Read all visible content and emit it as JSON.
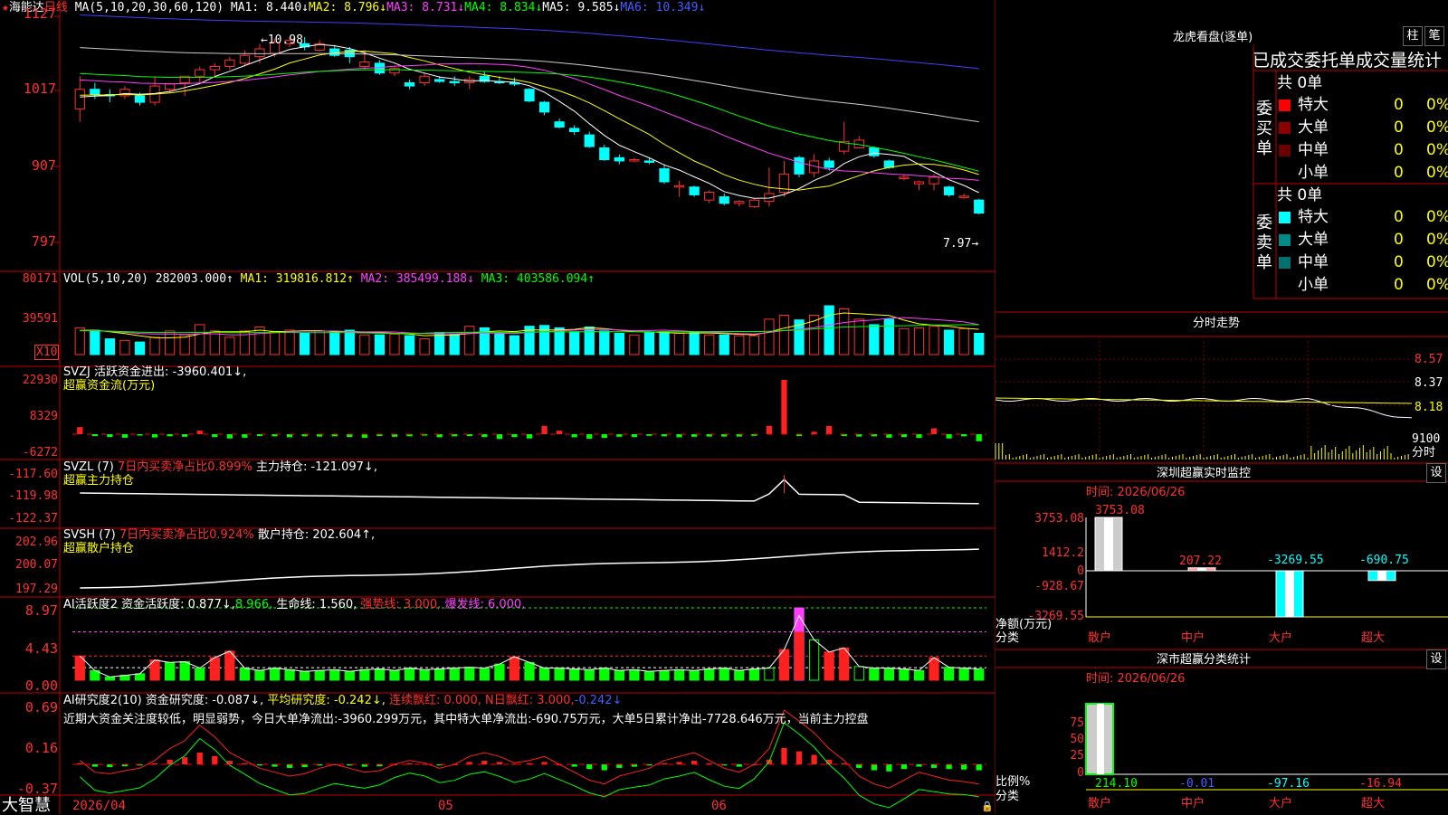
{
  "stock_name": "海能达",
  "period": "日线",
  "main_ma": {
    "label": "MA(5,10,20,30,60,120)",
    "ma1": "MA1: 8.440↓",
    "ma2": "MA2: 8.796↓",
    "ma3": "MA3: 8.731↓",
    "ma4": "MA4: 8.834↓",
    "ma5": "MA5: 9.585↓",
    "ma6": "MA6: 10.349↓"
  },
  "price_axis": [
    "1127",
    "1017",
    "907",
    "797"
  ],
  "high_mark": "10.98",
  "low_mark": "7.97",
  "vol": {
    "label": "VOL(5,10,20)",
    "value": "282003.000↑",
    "ma1": "MA1: 319816.812↑",
    "ma2": "MA2: 385499.188↓",
    "ma3": "MA3: 403586.094↑",
    "axis": [
      "80171",
      "39591"
    ],
    "unit": "X10"
  },
  "svzj": {
    "label": "SVZJ",
    "desc": "活跃资金进出: -3960.401↓,",
    "sub": "超赢资金流(万元)",
    "axis": [
      "22930",
      "8329",
      "-6272"
    ]
  },
  "svzl": {
    "label": "SVZL (7)",
    "ratio": "7日内买卖净占比0.899%",
    "hold": "主力持仓: -121.097↓,",
    "sub": "超赢主力持仓",
    "axis": [
      "-117.60",
      "-119.98",
      "-122.37"
    ]
  },
  "svsh": {
    "label": "SVSH (7)",
    "ratio": "7日内买卖净占比0.924%",
    "hold": "散户持仓: 202.604↑,",
    "sub": "超赢散户持仓",
    "axis": [
      "202.96",
      "200.07",
      "197.29"
    ]
  },
  "ai_act": {
    "label": "AI活跃度2",
    "v1": "资金活跃度: 0.877↓,",
    "v2": "8.966,",
    "v3": "生命线: 1.560,",
    "v4": "强势线: 3.000,",
    "v5": "爆发线: 6.000,",
    "axis": [
      "8.97",
      "4.43",
      "0.00"
    ]
  },
  "ai_res": {
    "label": "AI研究度2(10)",
    "v1": "资金研究度: -0.087↓,",
    "v2": "平均研究度: -0.242↓,",
    "v3": "连续飘红: 0.000,",
    "v4": "N日飘红: 3.000,",
    "v5": "-0.242↓",
    "text": "近期大资金关注度较低，明显弱势，今日大单净流出:-3960.299万元，其中特大单净流出:-690.75万元，大单5日累计净出-7728.646万元，当前主力控盘",
    "axis": [
      "0.69",
      "0.16",
      "-0.37"
    ]
  },
  "dates": [
    "2026/04",
    "05",
    "06"
  ],
  "brand": "大智慧",
  "right": {
    "lh_title": "龙虎看盘(逐单)",
    "btn_zhu": "柱",
    "btn_bi": "笔",
    "tabs_line": "已成交委托单成交量统计",
    "buy_label": "委买单",
    "sell_label": "委卖单",
    "buy_total": "共 0单",
    "sell_total": "共 0单",
    "buy_rows": [
      {
        "name": "特大",
        "n": "0",
        "p": "0%",
        "color": "#ff0000"
      },
      {
        "name": "大单",
        "n": "0",
        "p": "0%",
        "color": "#8b0000"
      },
      {
        "name": "中单",
        "n": "0",
        "p": "0%",
        "color": "#6a0000"
      },
      {
        "name": "小单",
        "n": "0",
        "p": "0%",
        "color": "#000000"
      }
    ],
    "sell_rows": [
      {
        "name": "特大",
        "n": "0",
        "p": "0%",
        "color": "#00ffff"
      },
      {
        "name": "大单",
        "n": "0",
        "p": "0%",
        "color": "#008b8b"
      },
      {
        "name": "中单",
        "n": "0",
        "p": "0%",
        "color": "#007070"
      },
      {
        "name": "小单",
        "n": "0",
        "p": "0%",
        "color": "#000000"
      }
    ],
    "fs_title": "分时走势",
    "fs_axis": [
      "8.57",
      "8.37",
      "8.18",
      "9100"
    ],
    "fs_unit": "分时",
    "mon_title": "深圳超赢实时监控",
    "mon_btn": "设",
    "mon_time": "时间: 2026/06/26",
    "mon_axis": [
      "3753.08",
      "1412.2",
      "0",
      "-928.67",
      "-3269.55"
    ],
    "mon_vals": [
      "3753.08",
      "207.22",
      "-3269.55",
      "-690.75"
    ],
    "mon_ylabel": "净额(万元)",
    "mon_xlabel": "分类",
    "cats": [
      "散户",
      "中户",
      "大户",
      "超大"
    ],
    "cls_title": "深市超赢分类统计",
    "cls_btn": "设",
    "cls_time": "时间: 2026/06/26",
    "cls_axis": [
      "75",
      "50",
      "25",
      "0"
    ],
    "cls_vals": [
      "214.10",
      "-0.01",
      "-97.16",
      "-16.94"
    ],
    "cls_ylabel": "比例%",
    "cls_xlabel": "分类"
  },
  "chart_data": {
    "type": "candlestick",
    "candles": [
      [
        9.9,
        10.4,
        9.7,
        10.2
      ],
      [
        10.2,
        10.3,
        10.05,
        10.12
      ],
      [
        10.12,
        10.2,
        10.0,
        10.1
      ],
      [
        10.1,
        10.25,
        10.05,
        10.2
      ],
      [
        10.1,
        10.15,
        9.95,
        10.0
      ],
      [
        10.0,
        10.4,
        9.95,
        10.25
      ],
      [
        10.2,
        10.3,
        10.15,
        10.28
      ],
      [
        10.3,
        10.35,
        10.1,
        10.4
      ],
      [
        10.4,
        10.55,
        10.3,
        10.5
      ],
      [
        10.5,
        10.6,
        10.4,
        10.55
      ],
      [
        10.55,
        10.7,
        10.5,
        10.65
      ],
      [
        10.6,
        10.8,
        10.55,
        10.72
      ],
      [
        10.7,
        10.9,
        10.6,
        10.82
      ],
      [
        10.75,
        10.98,
        10.7,
        10.92
      ],
      [
        10.9,
        11.0,
        10.85,
        10.95
      ],
      [
        10.9,
        11.0,
        10.8,
        10.85
      ],
      [
        10.8,
        10.95,
        10.78,
        10.9
      ],
      [
        10.82,
        10.88,
        10.7,
        10.72
      ],
      [
        10.8,
        10.85,
        10.6,
        10.7
      ],
      [
        10.55,
        10.8,
        10.5,
        10.62
      ],
      [
        10.6,
        10.65,
        10.42,
        10.45
      ],
      [
        10.45,
        10.55,
        10.4,
        10.52
      ],
      [
        10.3,
        10.35,
        10.2,
        10.25
      ],
      [
        10.3,
        10.45,
        10.25,
        10.4
      ],
      [
        10.35,
        10.4,
        10.3,
        10.32
      ],
      [
        10.32,
        10.4,
        10.25,
        10.3
      ],
      [
        10.3,
        10.4,
        10.2,
        10.35
      ],
      [
        10.4,
        10.48,
        10.3,
        10.32
      ],
      [
        10.32,
        10.4,
        10.28,
        10.3
      ],
      [
        10.3,
        10.38,
        10.25,
        10.28
      ],
      [
        10.2,
        10.22,
        10.0,
        10.02
      ],
      [
        10.0,
        10.02,
        9.8,
        9.85
      ],
      [
        9.7,
        9.75,
        9.6,
        9.62
      ],
      [
        9.6,
        9.65,
        9.5,
        9.55
      ],
      [
        9.5,
        9.55,
        9.3,
        9.32
      ],
      [
        9.3,
        9.35,
        9.1,
        9.12
      ],
      [
        9.15,
        9.2,
        9.05,
        9.1
      ],
      [
        9.1,
        9.15,
        9.08,
        9.12
      ],
      [
        9.1,
        9.15,
        9.05,
        9.08
      ],
      [
        8.98,
        9.05,
        8.75,
        8.78
      ],
      [
        8.7,
        8.8,
        8.55,
        8.72
      ],
      [
        8.7,
        8.72,
        8.55,
        8.58
      ],
      [
        8.5,
        8.65,
        8.45,
        8.62
      ],
      [
        8.55,
        8.6,
        8.42,
        8.45
      ],
      [
        8.45,
        8.5,
        8.4,
        8.48
      ],
      [
        8.4,
        8.52,
        8.38,
        8.5
      ],
      [
        8.48,
        9.0,
        8.4,
        8.6
      ],
      [
        8.62,
        9.1,
        8.55,
        8.9
      ],
      [
        9.15,
        9.18,
        8.85,
        8.9
      ],
      [
        8.92,
        9.2,
        8.85,
        9.1
      ],
      [
        9.1,
        9.15,
        8.95,
        9.0
      ],
      [
        9.25,
        9.7,
        9.2,
        9.4
      ],
      [
        9.3,
        9.48,
        9.3,
        9.42
      ],
      [
        9.3,
        9.32,
        9.15,
        9.18
      ],
      [
        9.1,
        9.12,
        8.98,
        9.0
      ],
      [
        8.85,
        8.9,
        8.8,
        8.85
      ],
      [
        8.75,
        8.8,
        8.65,
        8.78
      ],
      [
        8.75,
        8.9,
        8.65,
        8.85
      ],
      [
        8.7,
        8.72,
        8.55,
        8.58
      ],
      [
        8.55,
        8.6,
        8.52,
        8.56
      ],
      [
        8.5,
        8.52,
        8.28,
        8.3
      ]
    ],
    "volume_x10": [
      34000,
      31000,
      20000,
      18000,
      16000,
      22000,
      30000,
      25000,
      38000,
      30000,
      22000,
      30000,
      35000,
      29000,
      31000,
      27000,
      30000,
      28000,
      31000,
      25000,
      25000,
      26000,
      24000,
      20000,
      28000,
      26000,
      36000,
      34000,
      26000,
      24000,
      36000,
      37000,
      34000,
      29000,
      35000,
      30000,
      27000,
      25000,
      28000,
      29000,
      27000,
      28000,
      25000,
      25000,
      24000,
      24000,
      45000,
      50000,
      44000,
      50000,
      62000,
      58000,
      45000,
      38000,
      45000,
      33000,
      34000,
      36000,
      31000,
      33000,
      27000
    ],
    "zj": [
      3000,
      -800,
      -1200,
      -1500,
      -600,
      -1400,
      -900,
      -1100,
      1500,
      -1200,
      -1800,
      -1500,
      -800,
      -900,
      -1300,
      -900,
      -1000,
      -900,
      -1200,
      -1500,
      -800,
      -1100,
      -900,
      -600,
      -1300,
      -900,
      -800,
      -1200,
      -2000,
      -1200,
      -1800,
      3500,
      1500,
      -1300,
      -1900,
      -1600,
      -1100,
      -1200,
      -700,
      -900,
      -1300,
      -1100,
      -1000,
      -1000,
      -1000,
      -700,
      3500,
      23000,
      -800,
      1000,
      3500,
      -800,
      -1000,
      -900,
      -1500,
      -1200,
      -1600,
      2500,
      -1800,
      -900,
      -3000
    ],
    "act": [
      3.0,
      1.2,
      0.4,
      0.6,
      0.8,
      2.5,
      2.2,
      2.3,
      1.5,
      2.8,
      3.6,
      1.5,
      1.2,
      1.5,
      1.3,
      1.1,
      1.2,
      1.3,
      1.1,
      1.3,
      1.4,
      1.2,
      1.5,
      1.3,
      1.4,
      1.5,
      1.6,
      1.5,
      2.0,
      2.9,
      2.2,
      1.5,
      1.5,
      1.4,
      1.3,
      1.5,
      1.2,
      1.3,
      1.1,
      1.2,
      1.3,
      1.2,
      1.4,
      1.5,
      1.2,
      1.4,
      1.5,
      3.8,
      8.97,
      5.0,
      3.5,
      4.0,
      1.7,
      1.5,
      1.5,
      1.4,
      1.2,
      2.8,
      1.6,
      1.5,
      1.4
    ],
    "res": [
      0.05,
      -0.1,
      -0.12,
      -0.08,
      -0.05,
      0.05,
      0.2,
      0.3,
      0.5,
      0.35,
      0.15,
      0.05,
      -0.05,
      -0.1,
      -0.15,
      -0.12,
      -0.05,
      0.0,
      -0.05,
      -0.1,
      -0.08,
      0.0,
      0.05,
      0.02,
      -0.05,
      0.0,
      0.1,
      0.15,
      0.1,
      0.02,
      0.05,
      0.1,
      0.0,
      -0.1,
      -0.2,
      -0.25,
      -0.15,
      -0.1,
      -0.05,
      0.05,
      0.1,
      0.15,
      0.05,
      -0.05,
      -0.1,
      0.0,
      0.2,
      0.69,
      0.55,
      0.4,
      0.2,
      0.05,
      -0.15,
      -0.25,
      -0.3,
      -0.2,
      -0.1,
      -0.15,
      -0.2,
      -0.22,
      -0.25
    ]
  }
}
